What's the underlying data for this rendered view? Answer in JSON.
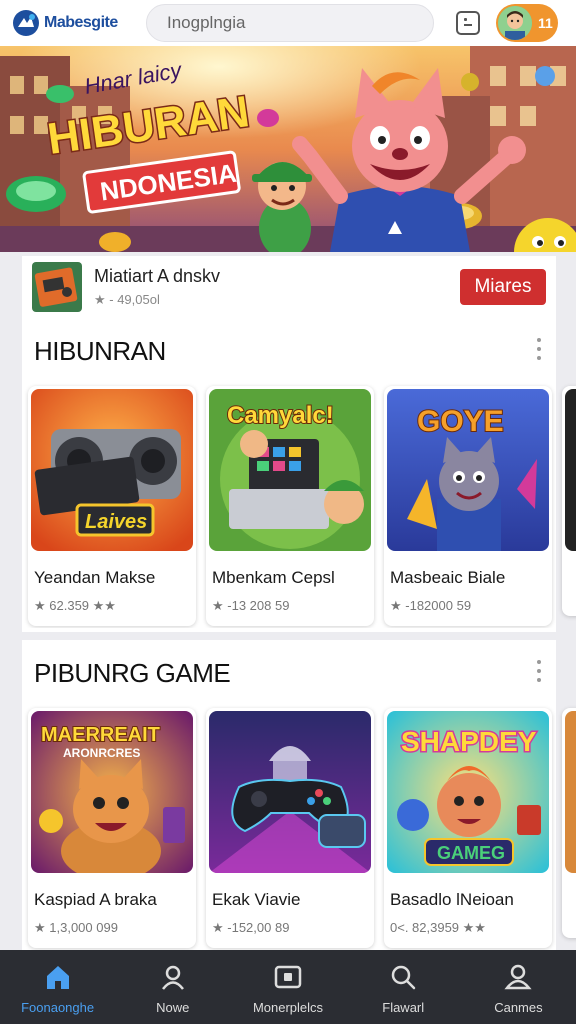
{
  "header": {
    "logo_text": "Mabesgite",
    "search_placeholder": "Inogplngia",
    "notification_count": "11"
  },
  "banner": {
    "line1": "Hnar laicy",
    "line2": "HIBURAN",
    "line3": "NDONESIA"
  },
  "featured_app": {
    "title": "Miatiart A dnskv",
    "rating": "★ - 49,05ol",
    "button_label": "Miares"
  },
  "sections": [
    {
      "title": "HIBUNRAN",
      "games": [
        {
          "title": "Yeandan Makse",
          "rating": "★ 62.359 ★★",
          "art_text": "Laives",
          "icon": "speaker-console-art"
        },
        {
          "title": "Mbenkam Cepsl",
          "rating": "★ -13 208 59",
          "art_text": "Camyalc!",
          "icon": "arcade-machine-art"
        },
        {
          "title": "Masbeaic Biale",
          "rating": "★ -182000 59",
          "art_text": "GOYE",
          "icon": "cat-mascot-art"
        }
      ]
    },
    {
      "title": "PIBUNRG GAME",
      "games": [
        {
          "title": "Kaspiad A braka",
          "rating": "★ 1,3,000 099",
          "art_text": "MAERREAIT",
          "art_sub": "ARONRCRES",
          "icon": "fox-mascot-art"
        },
        {
          "title": "Ekak Viavie",
          "rating": "★ -152,00 89",
          "art_text": "",
          "icon": "gamepad-art"
        },
        {
          "title": "Basadlo lNeioan",
          "rating": "0<. 82,3959 ★★",
          "art_text": "SHAPDEY",
          "art_sub": "GAMEG",
          "icon": "kid-mascot-art"
        }
      ]
    }
  ],
  "bottom_nav": [
    {
      "label": "Foonaonghe",
      "icon": "home-icon",
      "active": true
    },
    {
      "label": "Nowe",
      "icon": "person-icon",
      "active": false
    },
    {
      "label": "Monerplelcs",
      "icon": "library-icon",
      "active": false
    },
    {
      "label": "Flawarl",
      "icon": "search-icon",
      "active": false
    },
    {
      "label": "Canmes",
      "icon": "account-icon",
      "active": false
    }
  ],
  "colors": {
    "accent": "#4a9ff0",
    "install": "#cf2f2f",
    "chip": "#f0952e",
    "nav_bg": "#2b2d33"
  }
}
